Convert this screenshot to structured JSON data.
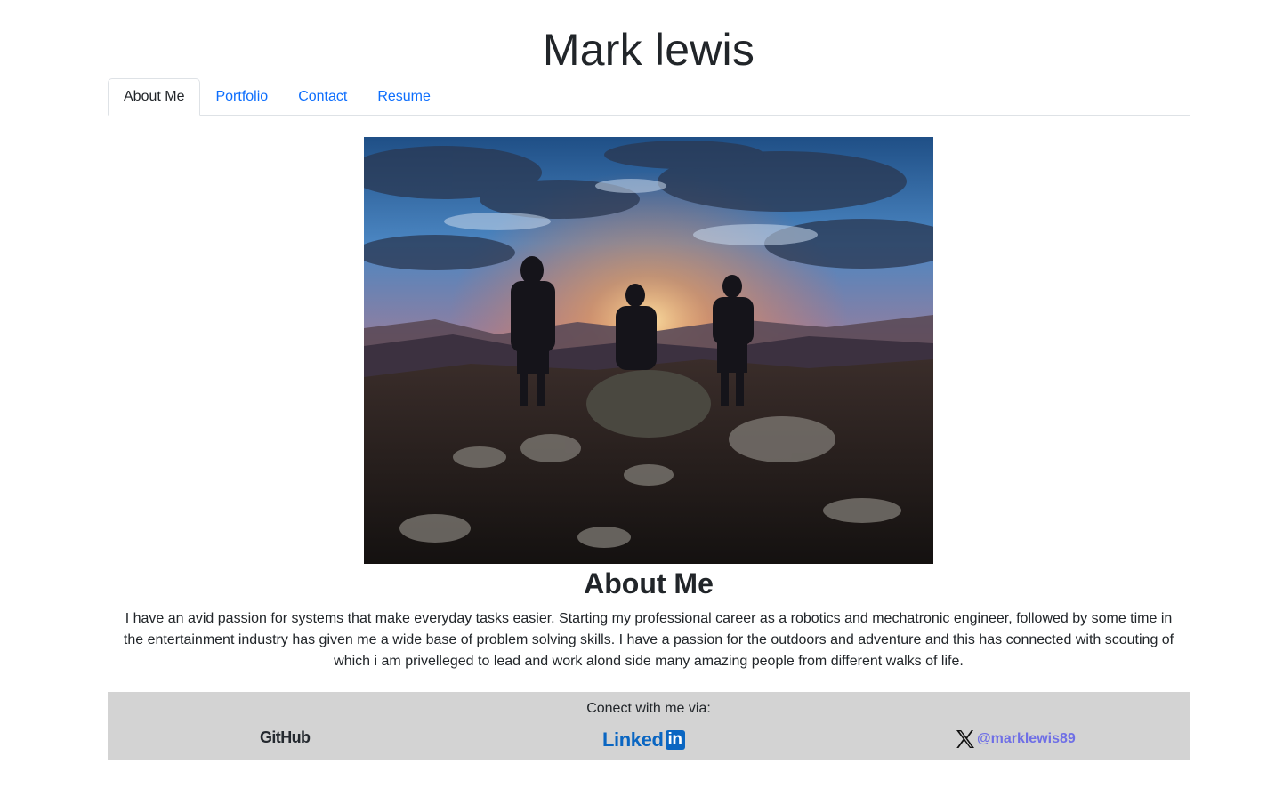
{
  "site": {
    "title": "Mark lewis"
  },
  "tabs": [
    {
      "label": "About Me",
      "active": true
    },
    {
      "label": "Portfolio",
      "active": false
    },
    {
      "label": "Contact",
      "active": false
    },
    {
      "label": "Resume",
      "active": false
    }
  ],
  "about": {
    "heading": "About Me",
    "text": "I have an avid passion for systems that make everyday tasks easier. Starting my professional career as a robotics and mechatronic engineer, followed by some time in the entertainment industry has given me a wide base of problem solving skills. I have a passion for the outdoors and adventure and this has connected with scouting of which i am privelleged to lead and work alond side many amazing people from different walks of life."
  },
  "footer": {
    "title": "Conect with me via:",
    "github_logo_text": "GitHub",
    "linkedin_logo_text": "Linked",
    "linkedin_logo_badge": "in",
    "x_handle": "@marklewis89"
  },
  "colors": {
    "link": "#0d6efd",
    "footer_bg": "#d3d3d3",
    "linkedin_blue": "#0a66c2",
    "x_handle": "#6f6fe6"
  },
  "icons": [
    "github-logo-icon",
    "linkedin-logo-icon",
    "x-logo-icon"
  ]
}
